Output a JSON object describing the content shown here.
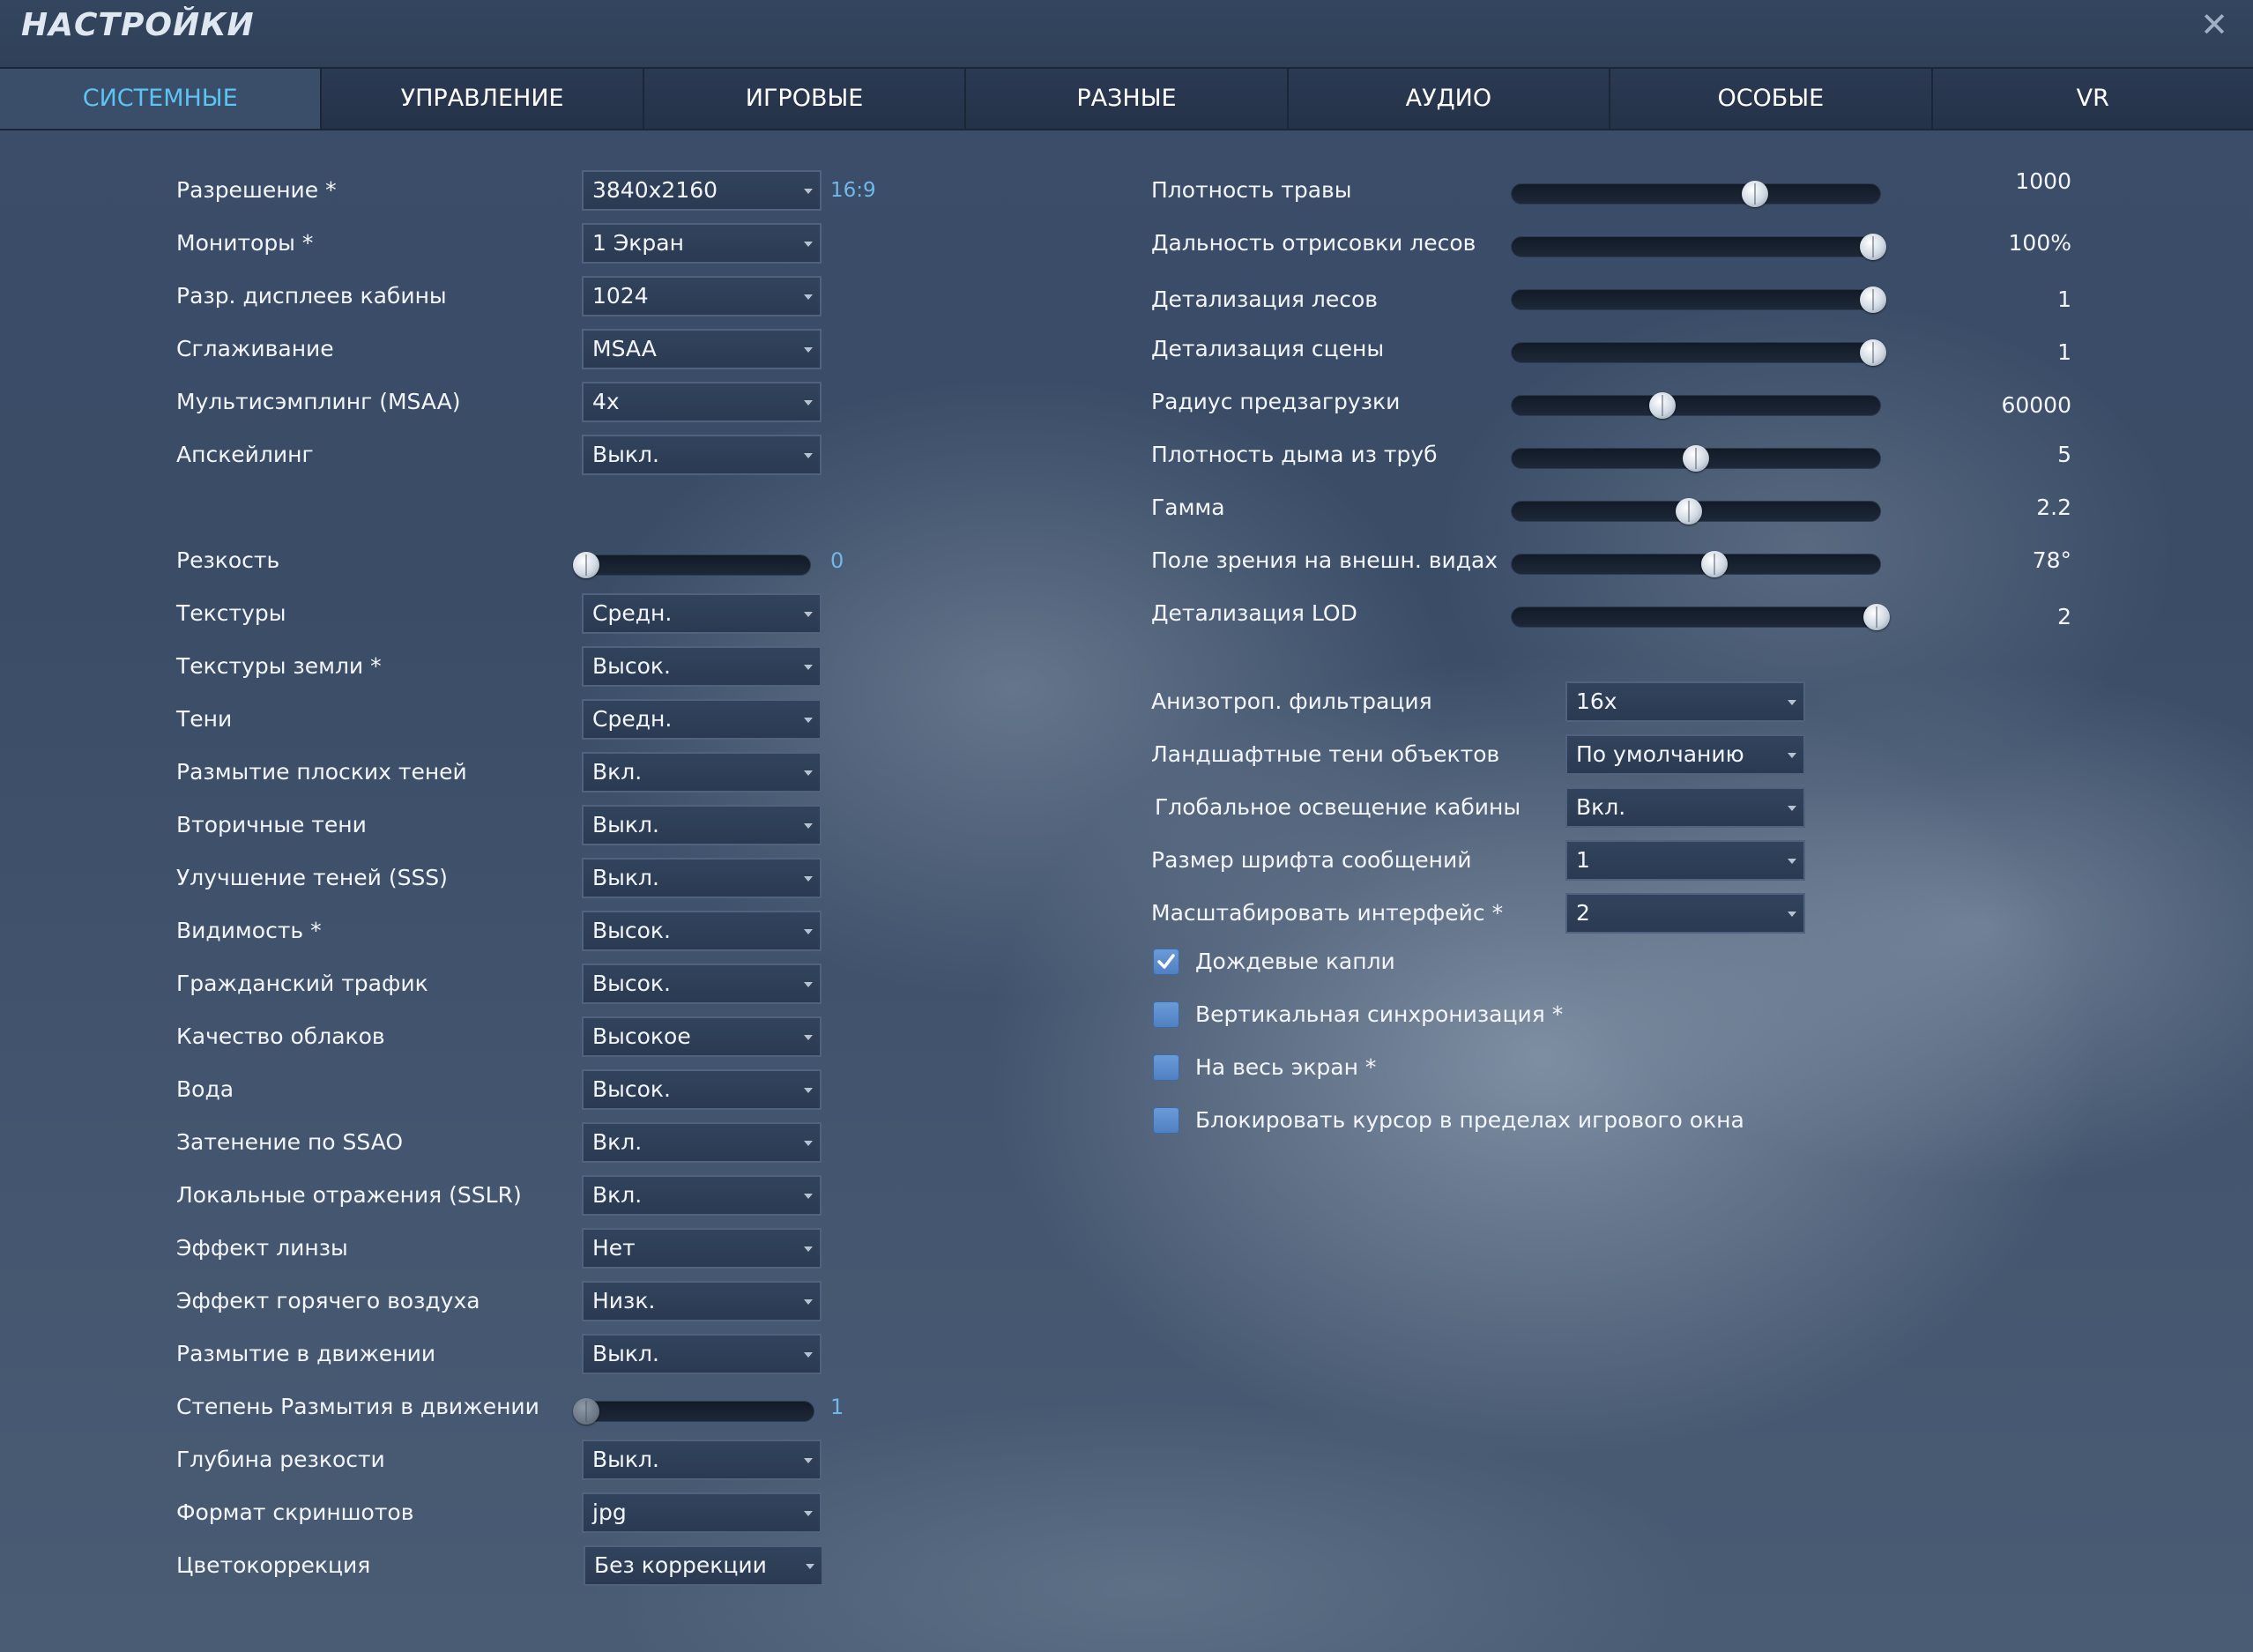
{
  "window": {
    "title": "НАСТРОЙКИ"
  },
  "tabs": [
    {
      "label": "СИСТЕМНЫЕ",
      "active": true
    },
    {
      "label": "УПРАВЛЕНИЕ"
    },
    {
      "label": "ИГРОВЫЕ"
    },
    {
      "label": "РАЗНЫЕ"
    },
    {
      "label": "АУДИО"
    },
    {
      "label": "ОСОБЫЕ"
    },
    {
      "label": "VR"
    }
  ],
  "left": {
    "resolution": {
      "label": "Разрешение *",
      "value": "3840x2160",
      "aspect": "16:9"
    },
    "monitors": {
      "label": "Мониторы *",
      "value": "1 Экран"
    },
    "cockpit_displays": {
      "label": "Разр. дисплеев кабины",
      "value": "1024"
    },
    "antialiasing": {
      "label": "Сглаживание",
      "value": "MSAA"
    },
    "msaa": {
      "label": "Мультисэмплинг (MSAA)",
      "value": "4x"
    },
    "upscaling": {
      "label": "Апскейлинг",
      "value": "Выкл."
    },
    "sharpness": {
      "label": "Резкость",
      "value": "0",
      "fraction": 0.0
    },
    "textures": {
      "label": "Текстуры",
      "value": "Средн."
    },
    "terrain_textures": {
      "label": "Текстуры земли *",
      "value": "Высок."
    },
    "shadows": {
      "label": "Тени",
      "value": "Средн."
    },
    "flat_shadow_blur": {
      "label": "Размытие плоских теней",
      "value": "Вкл."
    },
    "secondary_shadows": {
      "label": "Вторичные тени",
      "value": "Выкл."
    },
    "sss": {
      "label": "Улучшение теней (SSS)",
      "value": "Выкл."
    },
    "visibility": {
      "label": "Видимость *",
      "value": "Высок."
    },
    "civil_traffic": {
      "label": "Гражданский трафик",
      "value": "Высок."
    },
    "clouds": {
      "label": "Качество облаков",
      "value": "Высокое"
    },
    "water": {
      "label": "Вода",
      "value": "Высок."
    },
    "ssao": {
      "label": "Затенение по SSAO",
      "value": "Вкл."
    },
    "sslr": {
      "label": "Локальные отражения (SSLR)",
      "value": "Вкл."
    },
    "lens": {
      "label": "Эффект линзы",
      "value": "Нет"
    },
    "heat_blur": {
      "label": "Эффект горячего воздуха",
      "value": "Низк."
    },
    "motion_blur": {
      "label": "Размытие в движении",
      "value": "Выкл."
    },
    "motion_blur_amount": {
      "label": "Степень Размытия в движении",
      "value": "1",
      "fraction": 0.0
    },
    "dof": {
      "label": "Глубина резкости",
      "value": "Выкл."
    },
    "screenshot_format": {
      "label": "Формат скриншотов",
      "value": "jpg"
    },
    "color_grading": {
      "label": "Цветокоррекция",
      "value": "Без коррекции"
    }
  },
  "right": {
    "sliders": [
      {
        "label": "Плотность травы",
        "value": "1000",
        "fraction": 0.66
      },
      {
        "label": "Дальность отрисовки лесов",
        "value": "100%",
        "fraction": 0.98
      },
      {
        "label": "Детализация лесов",
        "value": "1",
        "fraction": 0.98
      },
      {
        "label": "Детализация сцены",
        "value": "1",
        "fraction": 0.98
      },
      {
        "label": "Радиус предзагрузки",
        "value": "60000",
        "fraction": 0.41
      },
      {
        "label": "Плотность дыма из труб",
        "value": "5",
        "fraction": 0.5
      },
      {
        "label": "Гамма",
        "value": "2.2",
        "fraction": 0.48
      },
      {
        "label": "Поле зрения на внешн. видах",
        "value": "78°",
        "fraction": 0.55
      },
      {
        "label": "Детализация LOD",
        "value": "2",
        "fraction": 0.99
      }
    ],
    "selects": [
      {
        "label": "Анизотроп. фильтрация",
        "value": "16x"
      },
      {
        "label": "Ландшафтные тени объектов",
        "value": "По умолчанию"
      },
      {
        "label": "Глобальное освещение кабины",
        "value": "Вкл."
      },
      {
        "label": "Размер шрифта сообщений",
        "value": "1"
      },
      {
        "label": "Масштабировать интерфейс *",
        "value": "2"
      }
    ],
    "checkboxes": [
      {
        "label": "Дождевые капли",
        "checked": true
      },
      {
        "label": "Вертикальная синхронизация *",
        "checked": false
      },
      {
        "label": "На весь экран *",
        "checked": false
      },
      {
        "label": "Блокировать курсор в пределах игрового окна",
        "checked": false
      }
    ]
  }
}
